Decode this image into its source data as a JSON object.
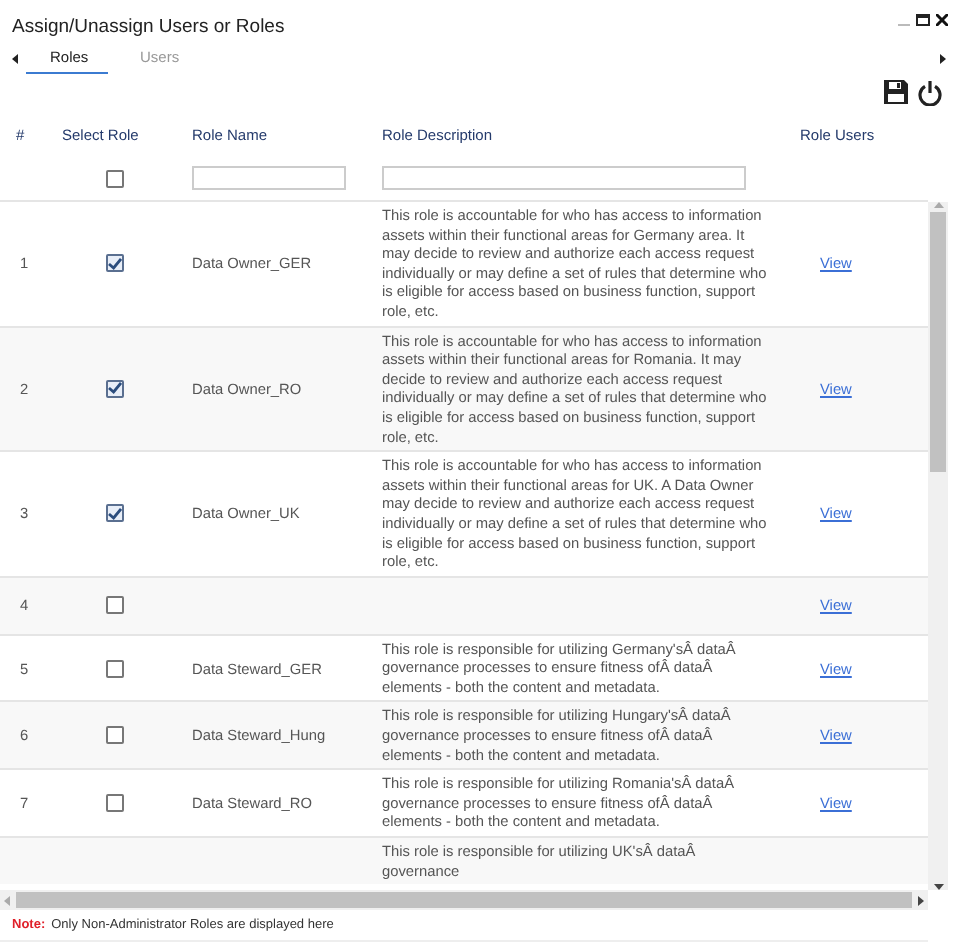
{
  "window": {
    "title": "Assign/Unassign Users or Roles"
  },
  "tabs": [
    {
      "label": "Roles",
      "selected": true
    },
    {
      "label": "Users",
      "selected": false
    }
  ],
  "table": {
    "columns": [
      "#",
      "Select Role",
      "Role Name",
      "Role Description",
      "Role Users"
    ],
    "filter": {
      "select_all_checked": false
    },
    "rows": [
      {
        "number": "1",
        "checked": true,
        "name": "Data Owner_GER",
        "description": "This role is accountable for who has access to information assets within their functional areas for Germany area. It may decide to review and authorize each access request individually or may define a set of rules that determine who is eligible for access based on business function, support role, etc.",
        "users": "View"
      },
      {
        "number": "2",
        "checked": true,
        "name": "Data Owner_RO",
        "description": "This role is accountable for who has access to information assets within their functional areas for Romania. It may decide to review and authorize each access request individually or may define a set of rules that determine who is eligible for access based on business function, support role, etc.",
        "users": "View"
      },
      {
        "number": "3",
        "checked": true,
        "name": "Data Owner_UK",
        "description": "This role is accountable for who has access to information assets within their functional areas for UK. A Data Owner may decide to review and authorize each access request individually or may define a set of rules that determine who is eligible for access based on business function, support role, etc.",
        "users": "View"
      },
      {
        "number": "4",
        "checked": false,
        "name": "",
        "description": "",
        "users": "View"
      },
      {
        "number": "5",
        "checked": false,
        "name": "Data Steward_GER",
        "description": "This role is responsible for utilizing Germany'sÂ dataÂ governance processes to ensure fitness ofÂ dataÂ elements - both the content and metadata.",
        "users": "View"
      },
      {
        "number": "6",
        "checked": false,
        "name": "Data Steward_Hung",
        "description": "This role is responsible for utilizing Hungary'sÂ dataÂ governance processes to ensure fitness ofÂ dataÂ elements - both the content and metadata.",
        "users": "View"
      },
      {
        "number": "7",
        "checked": false,
        "name": "Data Steward_RO",
        "description": "This role is responsible for utilizing Romania'sÂ dataÂ governance processes to ensure fitness ofÂ dataÂ elements - both the content and metadata.",
        "users": "View"
      },
      {
        "number": "",
        "checked": null,
        "name": "",
        "description": "This role is responsible for utilizing UK'sÂ dataÂ governance",
        "users": ""
      }
    ]
  },
  "note": {
    "label": "Note:",
    "text": "Only Non-Administrator Roles are displayed here"
  }
}
